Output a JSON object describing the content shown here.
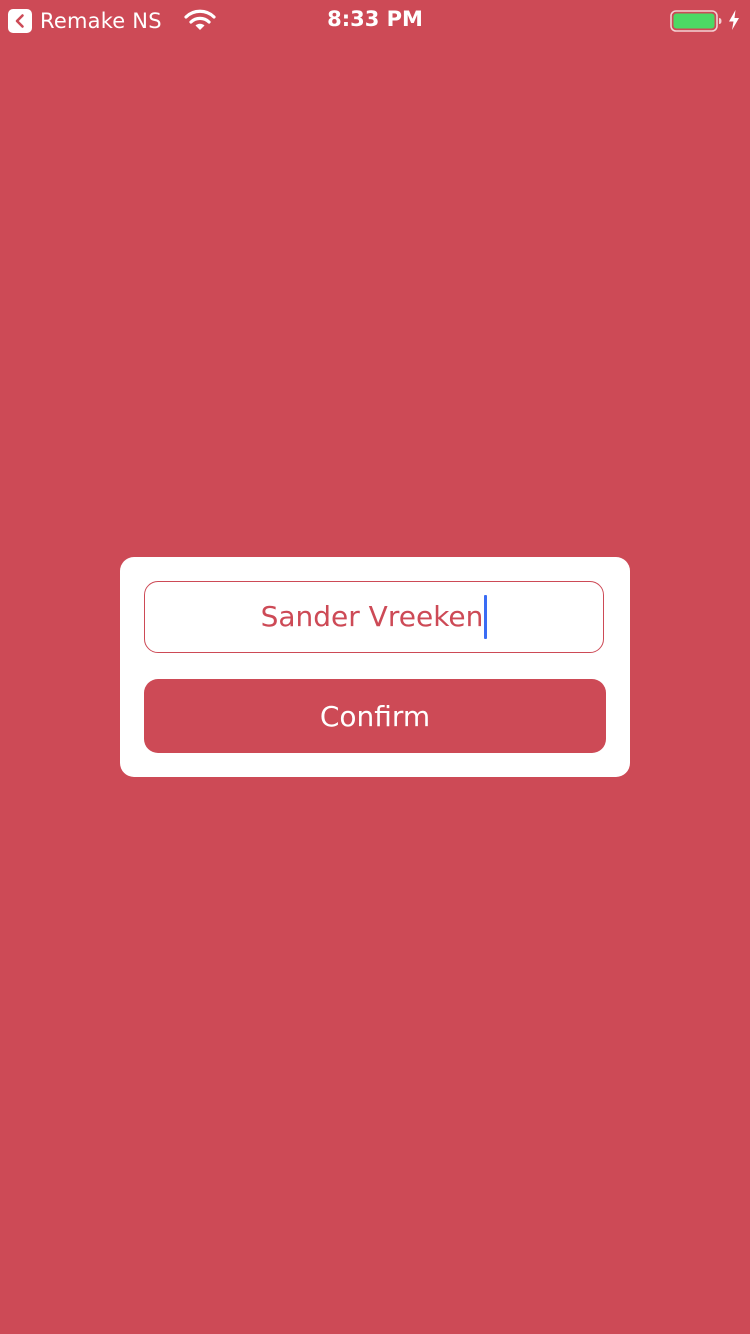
{
  "colors": {
    "background": "#CD4A56",
    "card": "#FFFFFF",
    "accent": "#CD4A56",
    "cursor": "#3A6CF4",
    "battery_fill": "#4CD964"
  },
  "status_bar": {
    "back_app_label": "Remake NS",
    "time": "8:33 PM",
    "wifi": "wifi-icon",
    "battery": "battery-full-charging-icon",
    "battery_level": 1.0,
    "charging": true
  },
  "dialog": {
    "name_field": {
      "value": "Sander Vreeken",
      "focused": true
    },
    "confirm_label": "Confirm"
  }
}
